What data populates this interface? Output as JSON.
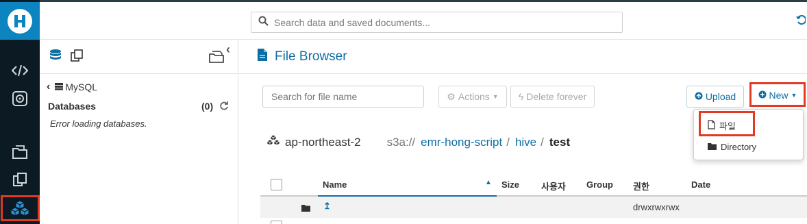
{
  "header": {
    "search_placeholder": "Search data and saved documents..."
  },
  "left_nav": {
    "items": [
      "editor-icon",
      "jobs-icon",
      "documents-icon",
      "copy-icon",
      "s3-browser-icon"
    ]
  },
  "assist": {
    "back_label": "MySQL",
    "databases_label": "Databases",
    "databases_count": "(0)",
    "error_text": "Error loading databases."
  },
  "main": {
    "title": "File Browser",
    "file_search_placeholder": "Search for file name",
    "actions_label": "Actions",
    "delete_label": "Delete forever",
    "upload_label": "Upload",
    "new_label": "New",
    "new_menu": {
      "file_label": "파일",
      "directory_label": "Directory"
    },
    "path": {
      "region": "ap-northeast-2",
      "scheme": "s3a://",
      "crumbs": [
        "emr-hong-script",
        "hive"
      ],
      "current": "test"
    },
    "table": {
      "columns": [
        "Name",
        "Size",
        "사용자",
        "Group",
        "권한",
        "Date"
      ],
      "rows": [
        {
          "name": "",
          "size": "",
          "user": "",
          "group": "",
          "permissions": "drwxrwxrwx",
          "date": ""
        }
      ]
    }
  },
  "colors": {
    "accent": "#0b6fa4",
    "nav_bg": "#0b1a23",
    "logo_bg": "#0b84bf",
    "highlight": "#e23a21"
  }
}
